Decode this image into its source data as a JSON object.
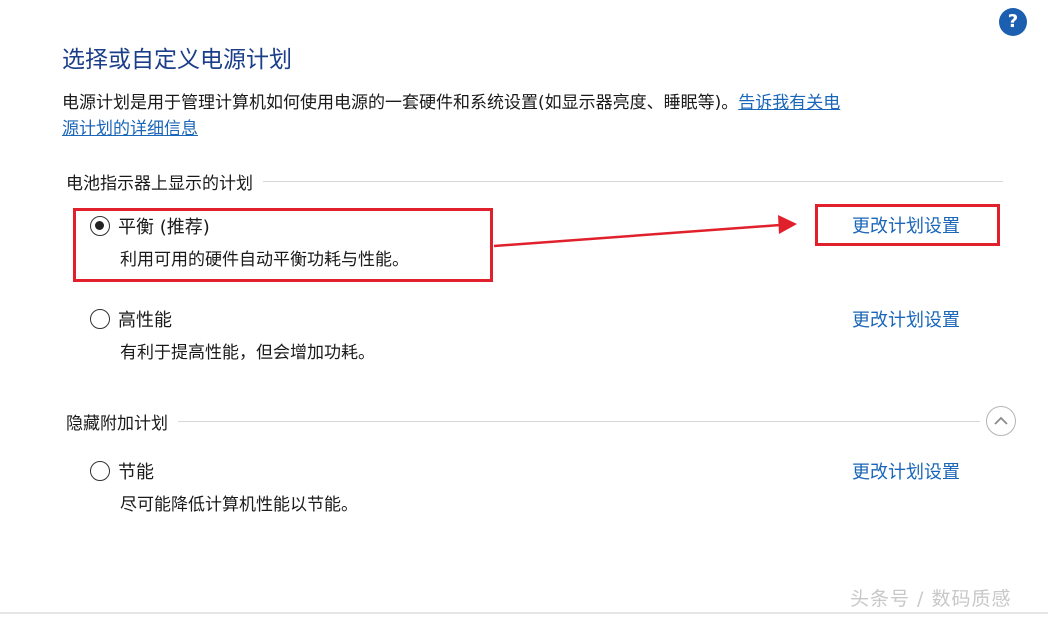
{
  "header": {
    "title": "选择或自定义电源计划",
    "help_icon": "question-icon"
  },
  "description": {
    "text": "电源计划是用于管理计算机如何使用电源的一套硬件和系统设置(如显示器亮度、睡眠等)。",
    "link_text_part1": "告诉我有关电",
    "link_text_part2": "源计划的详细信息"
  },
  "battery_section": {
    "heading": "电池指示器上显示的计划",
    "plans": [
      {
        "name": "平衡 (推荐)",
        "description": "利用可用的硬件自动平衡功耗与性能。",
        "selected": true,
        "change_link": "更改计划设置"
      },
      {
        "name": "高性能",
        "description": "有利于提高性能，但会增加功耗。",
        "selected": false,
        "change_link": "更改计划设置"
      }
    ]
  },
  "hidden_section": {
    "heading": "隐藏附加计划",
    "collapse_icon": "chevron-up-icon",
    "plans": [
      {
        "name": "节能",
        "description": "尽可能降低计算机性能以节能。",
        "selected": false,
        "change_link": "更改计划设置"
      }
    ]
  },
  "annotation": {
    "color": "#e0212c"
  },
  "watermark": "头条号 / 数码质感",
  "colors": {
    "title": "#1b3e8a",
    "link": "#1a66b8",
    "help_badge": "#1c5fb0"
  }
}
